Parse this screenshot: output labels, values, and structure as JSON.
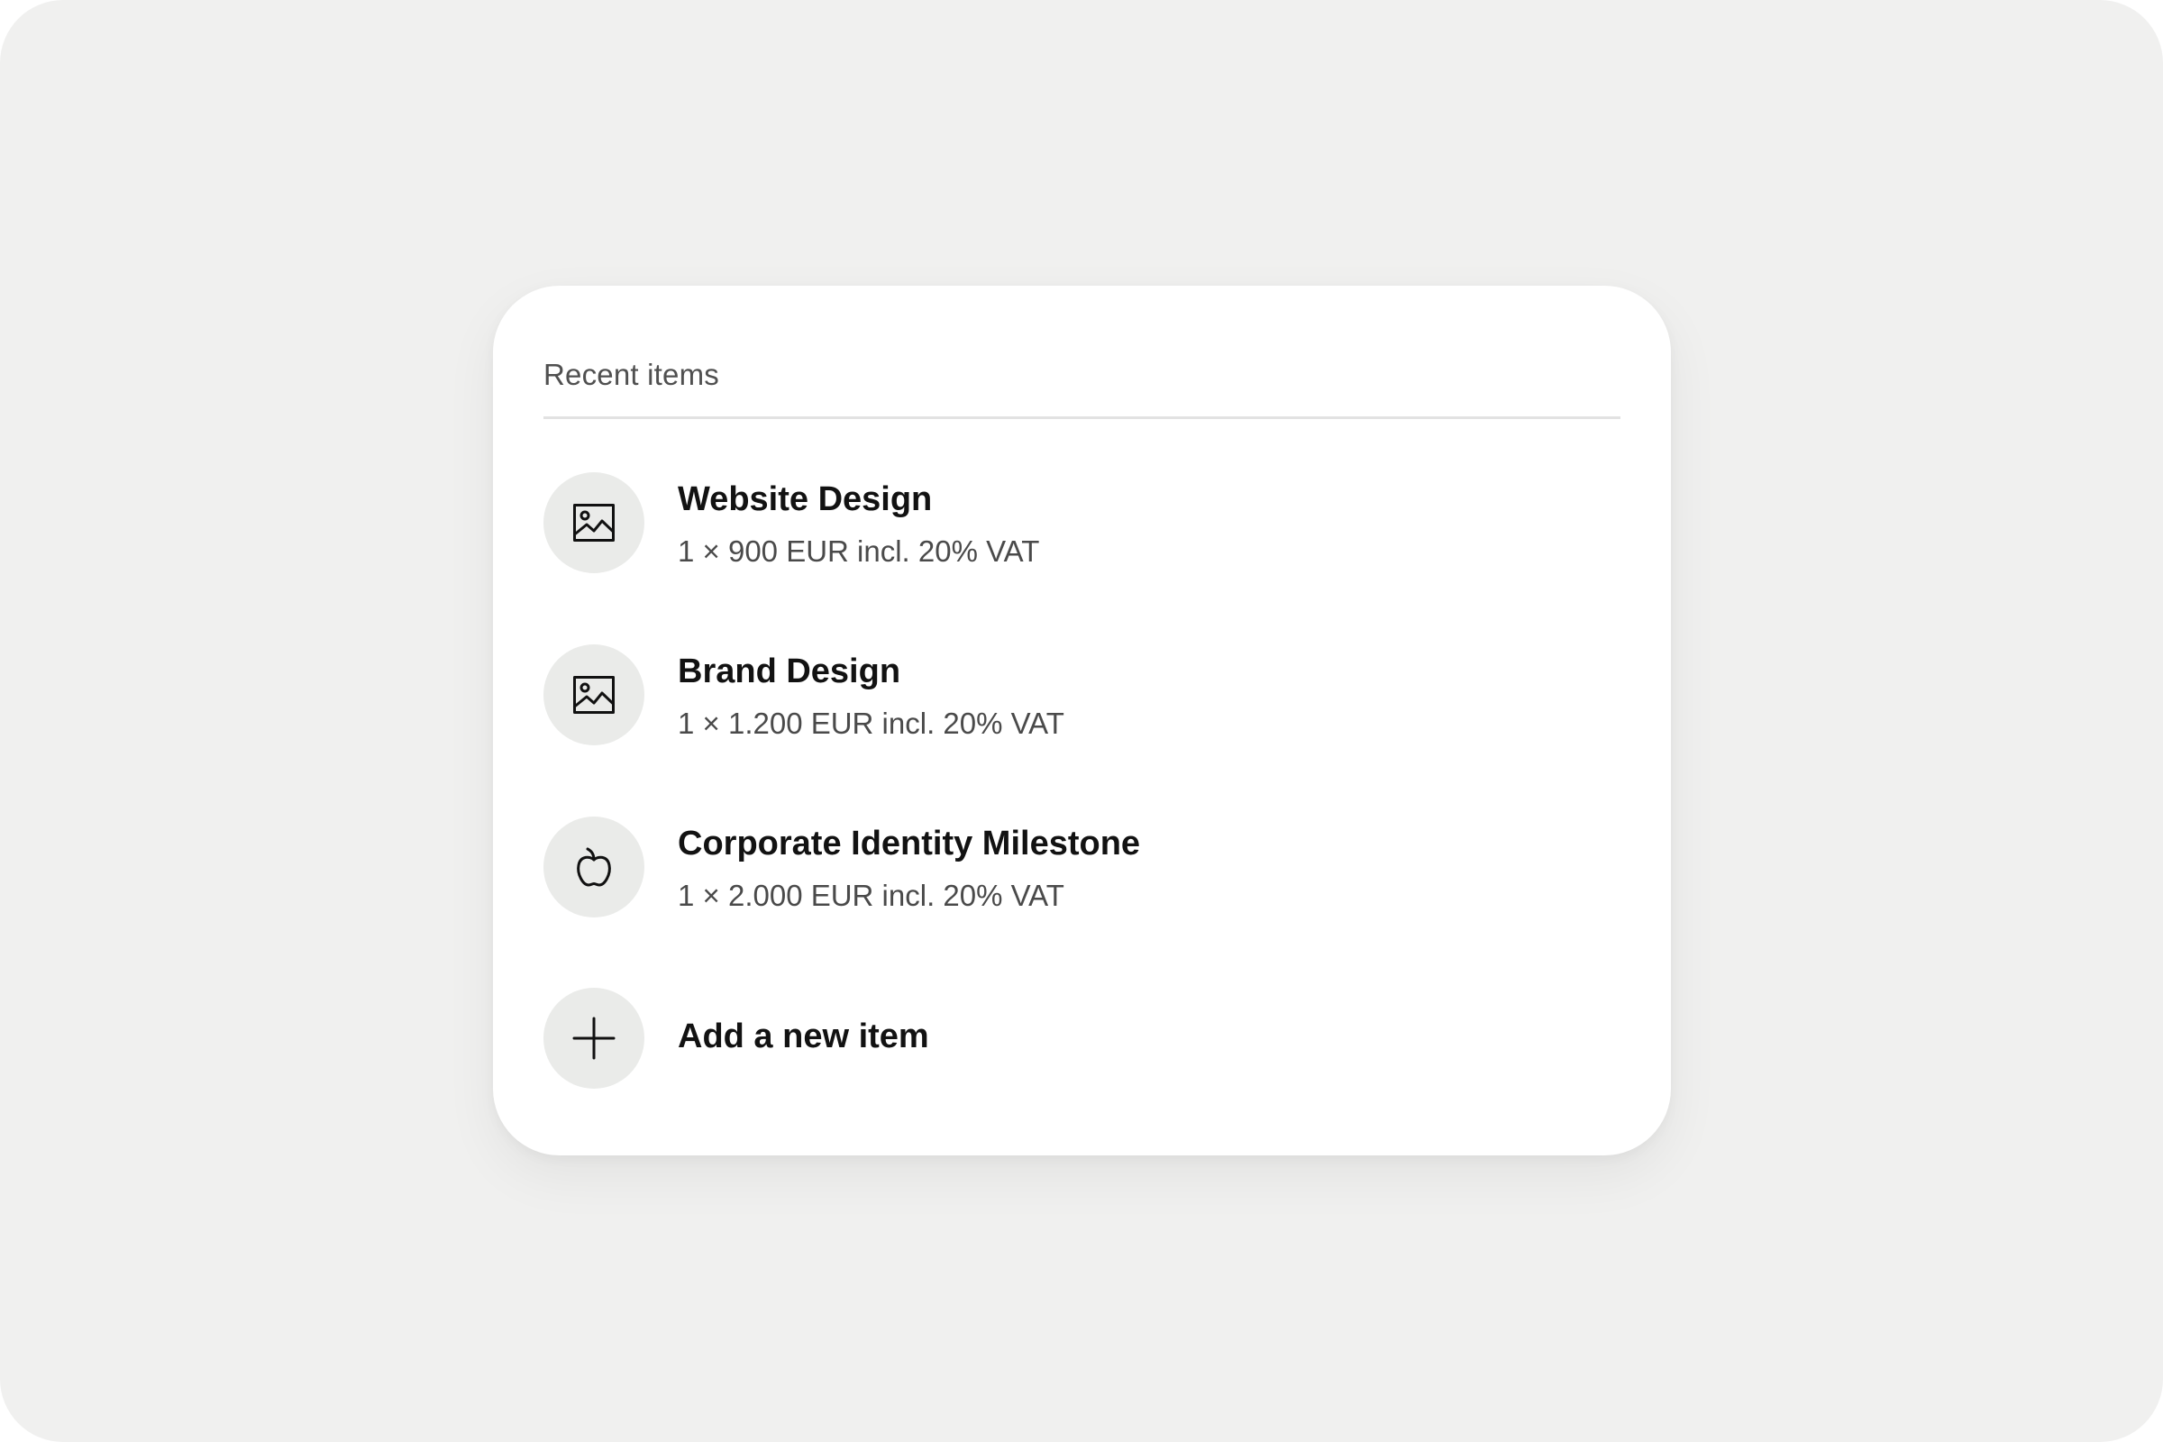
{
  "recent": {
    "title": "Recent items",
    "items": [
      {
        "name": "Website Design",
        "detail": "1 × 900 EUR incl. 20% VAT",
        "icon": "image-icon"
      },
      {
        "name": "Brand Design",
        "detail": "1 × 1.200 EUR incl. 20% VAT",
        "icon": "image-icon"
      },
      {
        "name": "Corporate Identity Milestone",
        "detail": "1 × 2.000 EUR incl. 20% VAT",
        "icon": "apple-icon"
      }
    ],
    "add_label": "Add a new item",
    "add_icon": "plus-icon"
  },
  "colors": {
    "page_background": "#f0f0ef",
    "card_background": "#ffffff",
    "icon_circle": "#eaebe9",
    "title_text": "#121212",
    "secondary_text": "#4a4a4a"
  }
}
